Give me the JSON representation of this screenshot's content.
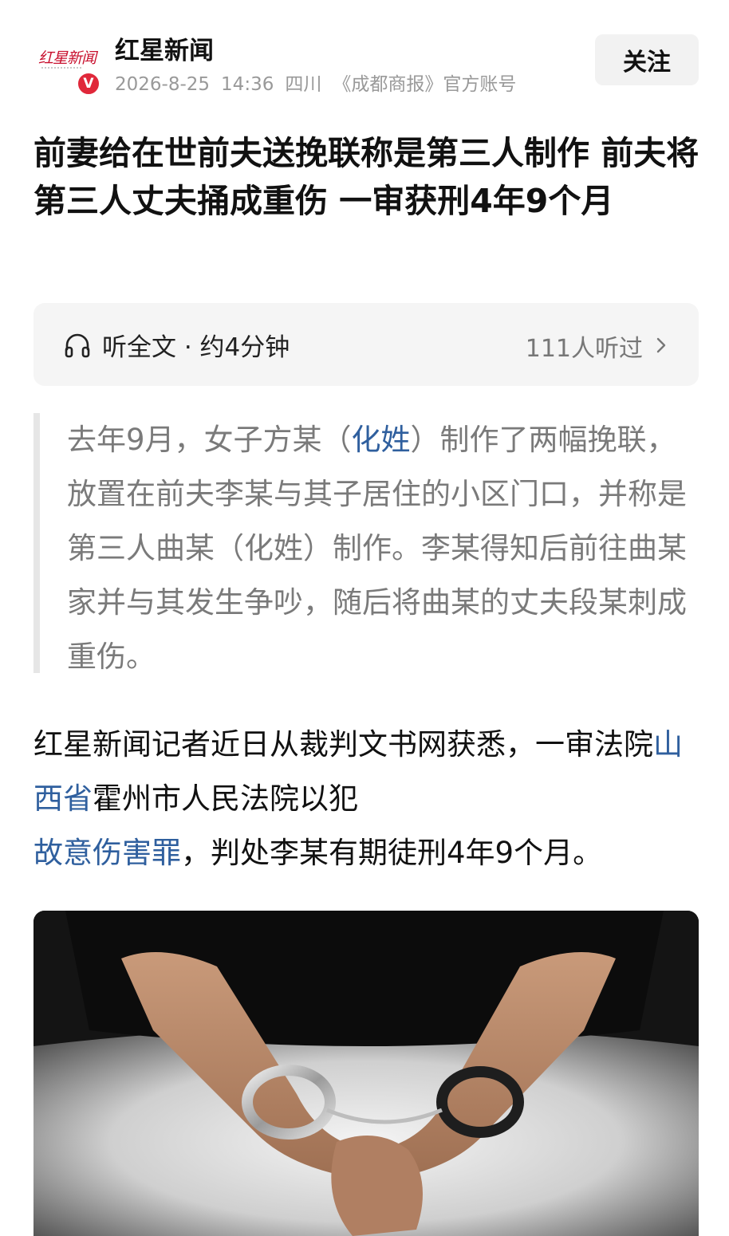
{
  "header": {
    "avatar_text": "红星新闻",
    "verified_badge": "V",
    "source_name": "红星新闻",
    "date": "2026-8-25",
    "time": "14:36",
    "region": "四川",
    "account": "《成都商报》官方账号",
    "follow_label": "关注"
  },
  "article": {
    "title": "前妻给在世前夫送挽联称是第三人制作 前夫将第三人丈夫捅成重伤 一审获刑4年9个月",
    "listen": {
      "label": "听全文 · 约4分钟",
      "count": "111人听过"
    },
    "summary": {
      "part1": "去年9月，女子方某（",
      "link": "化姓",
      "part2": "）制作了两幅挽联，放置在前夫李某与其子居住的小区门口，并称是第三人曲某（化姓）制作。李某得知后前往曲某家并与其发生争吵，随后将曲某的丈夫段某刺成重伤。"
    },
    "body": {
      "part1": "红星新闻记者近日从裁判文书网获悉，一审法院",
      "link1": "山西省",
      "part2": "霍州市人民法院以犯",
      "link2": "故意伤害罪",
      "part3": "，判处李某有期徒刑4年9个月。"
    }
  },
  "colors": {
    "link": "#2f5f9e",
    "badge": "#e0283a",
    "logo": "#c8102e",
    "meta": "#999999"
  }
}
